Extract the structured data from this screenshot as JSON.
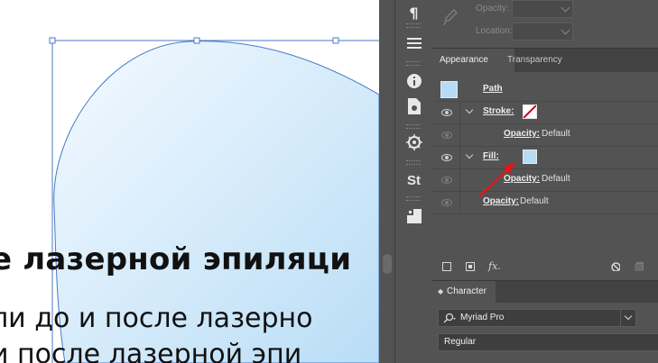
{
  "canvas": {
    "heading": "е лазерной эпиляци",
    "body_line1": "ли до и после лазерно",
    "body_line2": "и после лазерной эпи"
  },
  "gradient": {
    "opacity_label": "Opacity:",
    "location_label": "Location:"
  },
  "tabs": [
    {
      "label": "Appearance",
      "active": true
    },
    {
      "label": "Transparency",
      "active": false
    }
  ],
  "appearance": {
    "path_label": "Path",
    "stroke_label": "Stroke:",
    "stroke_opacity_label": "Opacity:",
    "stroke_opacity_value": "Default",
    "fill_label": "Fill:",
    "fill_opacity_label": "Opacity:",
    "fill_opacity_value": "Default",
    "opacity_label": "Opacity:",
    "opacity_value": "Default"
  },
  "bottom_bar": {
    "fx_label": "fx."
  },
  "character": {
    "tab_label": "Character",
    "font_family": "Myriad Pro",
    "font_style": "Regular"
  },
  "colors": {
    "panel_bg": "#535353",
    "fill_swatch": "#b6dcf5",
    "stroke_red": "#d0021b",
    "arrow_red": "#e01818",
    "selection_blue": "#4a7ac7"
  }
}
